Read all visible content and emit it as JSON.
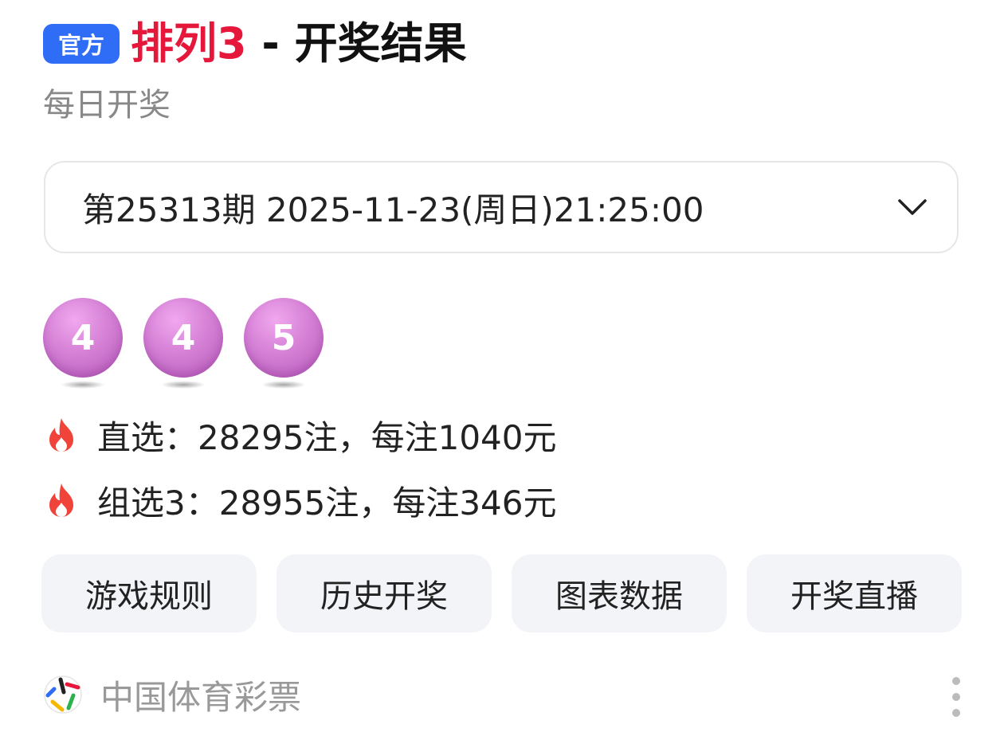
{
  "header": {
    "badge": "官方",
    "title_game": "排列3",
    "title_rest": " - 开奖结果",
    "subtitle": "每日开奖"
  },
  "period_select": {
    "value": "第25313期 2025-11-23(周日)21:25:00",
    "icon": "chevron-down-icon"
  },
  "balls": [
    "4",
    "4",
    "5"
  ],
  "prizes": [
    {
      "text": "直选：28295注，每注1040元",
      "icon": "fire-icon"
    },
    {
      "text": "组选3：28955注，每注346元",
      "icon": "fire-icon"
    }
  ],
  "buttons": [
    {
      "label": "游戏规则"
    },
    {
      "label": "历史开奖"
    },
    {
      "label": "图表数据"
    },
    {
      "label": "开奖直播"
    }
  ],
  "footer": {
    "source": "中国体育彩票",
    "logo": "lottery-logo-icon",
    "more_icon": "more-vertical-icon"
  },
  "colors": {
    "badge_bg": "#2f6df6",
    "title_red": "#e5183c",
    "ball": "#d884d8",
    "fire": "#f0443a"
  }
}
